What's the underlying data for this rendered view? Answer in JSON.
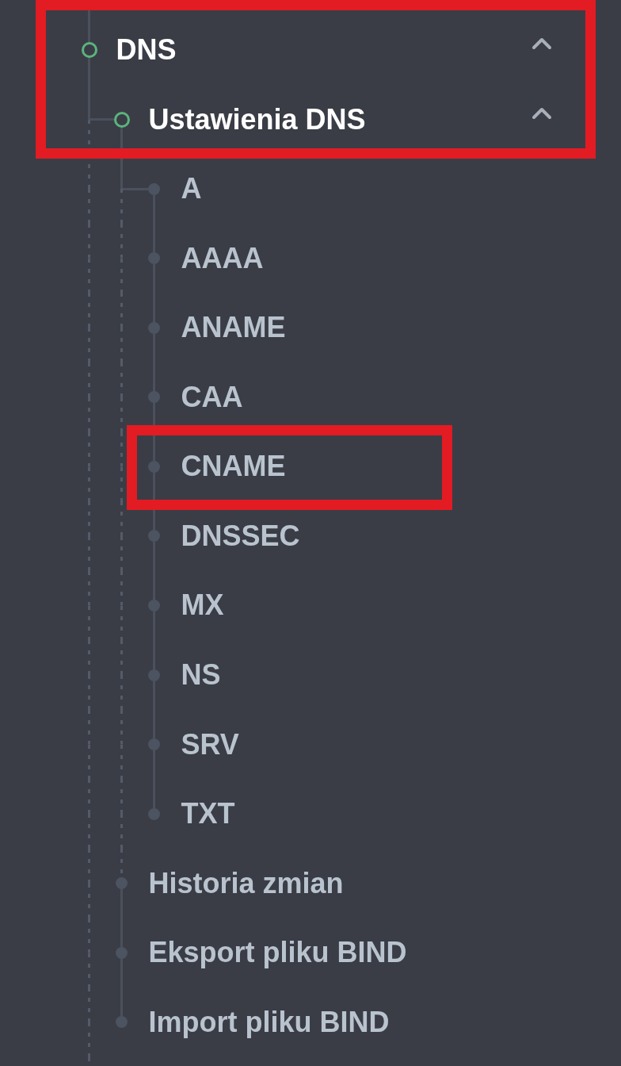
{
  "sidebar": {
    "items": [
      {
        "label": "DNS",
        "active": true,
        "expanded": true,
        "highlighted": true,
        "children": [
          {
            "label": "Ustawienia DNS",
            "active": true,
            "expanded": true,
            "highlighted": true,
            "children": [
              {
                "label": "A",
                "active": false,
                "highlighted": false
              },
              {
                "label": "AAAA",
                "active": false,
                "highlighted": false
              },
              {
                "label": "ANAME",
                "active": false,
                "highlighted": false
              },
              {
                "label": "CAA",
                "active": false,
                "highlighted": false
              },
              {
                "label": "CNAME",
                "active": false,
                "highlighted": true
              },
              {
                "label": "DNSSEC",
                "active": false,
                "highlighted": false
              },
              {
                "label": "MX",
                "active": false,
                "highlighted": false
              },
              {
                "label": "NS",
                "active": false,
                "highlighted": false
              },
              {
                "label": "SRV",
                "active": false,
                "highlighted": false
              },
              {
                "label": "TXT",
                "active": false,
                "highlighted": false
              }
            ]
          },
          {
            "label": "Historia zmian",
            "active": false,
            "highlighted": false
          },
          {
            "label": "Eksport pliku BIND",
            "active": false,
            "highlighted": false
          },
          {
            "label": "Import pliku BIND",
            "active": false,
            "highlighted": false
          }
        ]
      }
    ]
  }
}
